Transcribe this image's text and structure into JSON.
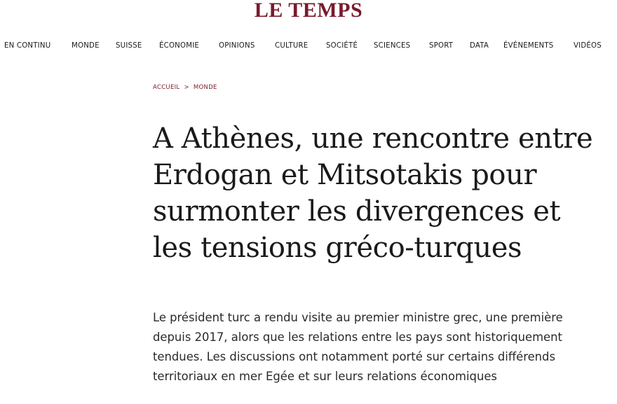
{
  "site": {
    "logo": "LE TEMPS",
    "brand_color": "#7a1a2c"
  },
  "nav": {
    "items": [
      "EN CONTINU",
      "MONDE",
      "SUISSE",
      "ÉCONOMIE",
      "OPINIONS",
      "CULTURE",
      "SOCIÉTÉ",
      "SCIENCES",
      "SPORT",
      "DATA",
      "ÉVÉNEMENTS",
      "VIDÉOS"
    ]
  },
  "breadcrumb": {
    "home": "ACCUEIL",
    "separator": ">",
    "section": "MONDE"
  },
  "article": {
    "headline": "A Athènes, une rencontre entre Erdogan et Mitsotakis pour surmonter les divergences et les tensions gréco-turques",
    "lead": "Le président turc a rendu visite au premier ministre grec, une première depuis 2017, alors que les relations entre les pays sont historiquement tendues. Les discussions ont notamment porté sur certains différends territoriaux en mer Egée et sur leurs relations économiques"
  }
}
